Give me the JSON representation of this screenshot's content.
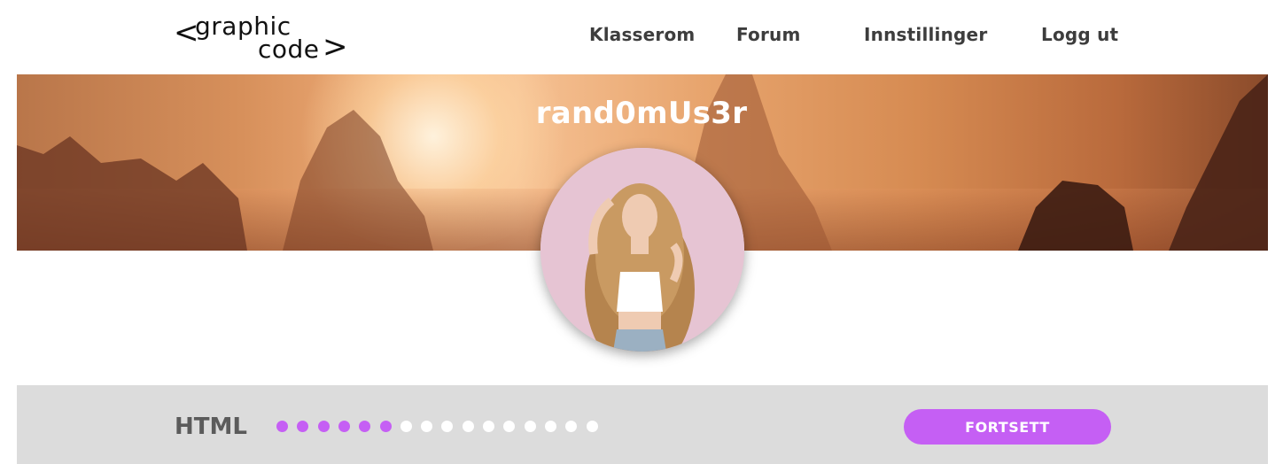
{
  "logo": {
    "left_bracket": "<",
    "word_top": "graphic",
    "word_bottom": "code",
    "right_bracket": ">"
  },
  "nav": {
    "items": [
      "Klasserom",
      "Forum",
      "Innstillinger",
      "Logg ut"
    ]
  },
  "profile": {
    "username": "rand0mUs3r"
  },
  "course": {
    "label": "HTML",
    "progress": {
      "completed": 6,
      "total": 16
    },
    "continue_label": "FORTSETT"
  },
  "colors": {
    "accent": "#c55ff4",
    "dot_inactive": "#ffffff",
    "progress_bg": "#dcdcdc"
  }
}
